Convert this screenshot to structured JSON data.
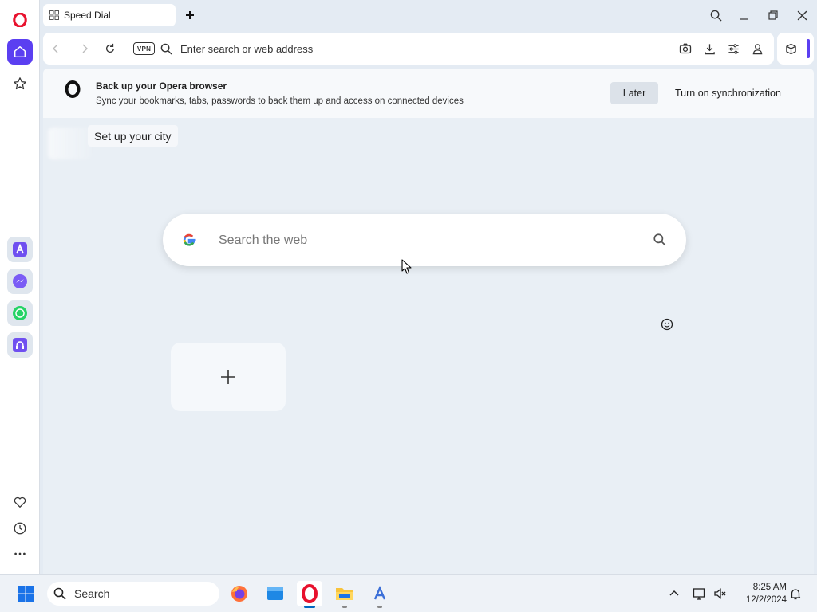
{
  "browser": {
    "tab": {
      "title": "Speed Dial"
    },
    "address_bar": {
      "placeholder": "Enter search or web address",
      "vpn_label": "VPN"
    }
  },
  "sync_banner": {
    "title": "Back up your Opera browser",
    "description": "Sync your bookmarks, tabs, passwords to back them up and access on connected devices",
    "later_label": "Later",
    "sync_label": "Turn on synchronization"
  },
  "speed_dial": {
    "city_prompt": "Set up your city",
    "search_placeholder": "Search the web"
  },
  "taskbar": {
    "search_label": "Search",
    "time": "8:25 AM",
    "date": "12/2/2024"
  },
  "colors": {
    "accent": "#5b3ff1",
    "opera_red": "#e8112d"
  }
}
